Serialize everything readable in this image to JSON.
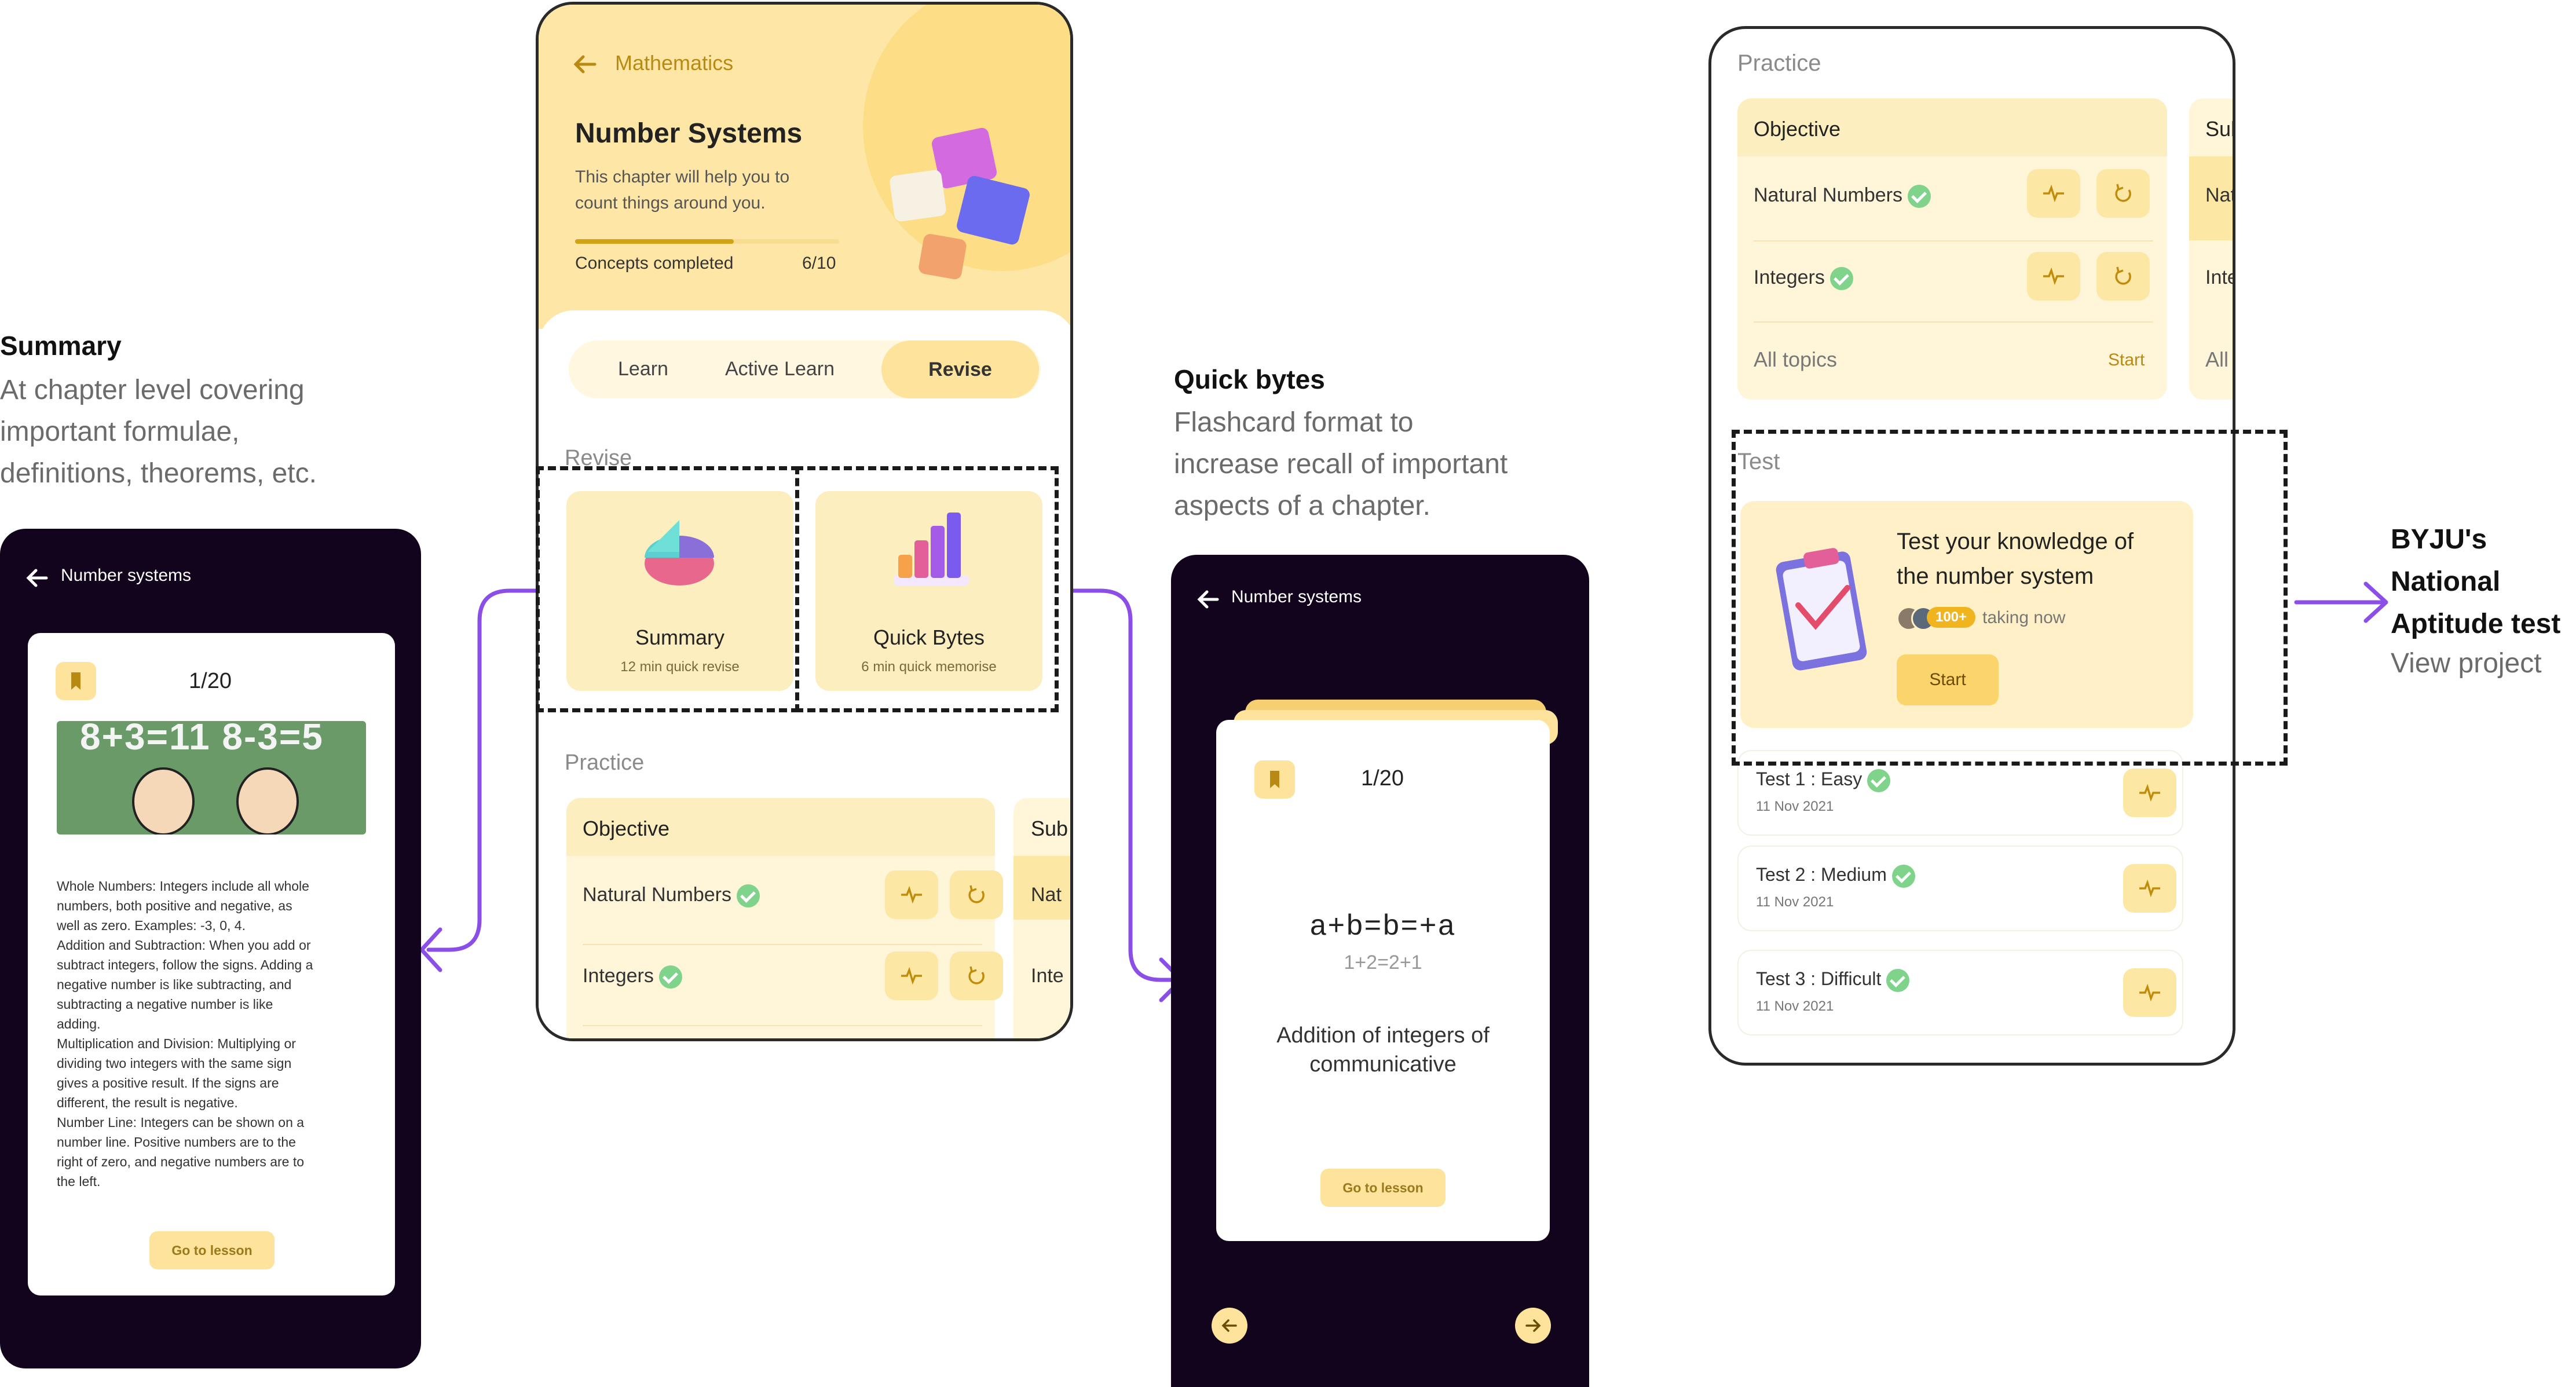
{
  "annotations": {
    "summary": {
      "title": "Summary",
      "lines": [
        "At chapter level covering",
        "important formulae,",
        "definitions, theorems, etc."
      ]
    },
    "quick_bytes": {
      "title": "Quick bytes",
      "lines": [
        "Flashcard format to",
        "increase recall of important",
        "aspects of a chapter."
      ]
    },
    "byjus": {
      "title_lines": [
        "BYJU's",
        "National",
        "Aptitude test"
      ],
      "link": "View project"
    }
  },
  "summary_screen": {
    "header": "Number systems",
    "counter": "1/20",
    "image_text": "8+3=11  8-3=5",
    "paragraphs": [
      "Whole Numbers: Integers include all whole",
      "numbers, both positive and negative, as",
      "well as zero. Examples: -3, 0, 4.",
      "Addition and Subtraction: When you add or",
      "subtract integers, follow the signs. Adding a",
      "negative number is like subtracting, and",
      "subtracting a negative number is like",
      "adding.",
      "Multiplication and Division: Multiplying or",
      "dividing two integers with the same sign",
      "gives a positive result. If the signs are",
      "different, the result is negative.",
      "Number Line: Integers can be shown on a",
      "number line. Positive numbers are to the",
      "right of zero, and negative numbers are to",
      "the left."
    ],
    "button": "Go to lesson"
  },
  "chapter_screen": {
    "back_label": "Mathematics",
    "title": "Number Systems",
    "description_lines": [
      "This chapter will help you to",
      "count things around you."
    ],
    "progress_label": "Concepts completed",
    "progress_value": "6/10",
    "progress_fraction": 0.6,
    "tabs": [
      "Learn",
      "Active Learn",
      "Revise"
    ],
    "active_tab": "Revise",
    "revise_heading": "Revise",
    "summary_card": {
      "title": "Summary",
      "subtitle": "12 min quick revise"
    },
    "quick_card": {
      "title": "Quick Bytes",
      "subtitle": "6 min quick memorise"
    },
    "practice_heading": "Practice",
    "objective_heading": "Objective",
    "side_heading": "Sub",
    "topics": [
      "Natural Numbers",
      "Integers"
    ],
    "side_topics": [
      "Nat",
      "Inte"
    ]
  },
  "flash_screen": {
    "header": "Number systems",
    "counter": "1/20",
    "formula": "a+b=b=+a",
    "example": "1+2=2+1",
    "caption_lines": [
      "Addition of integers of",
      "communicative"
    ],
    "button": "Go to lesson"
  },
  "practice_screen": {
    "heading": "Practice",
    "objective_heading": "Objective",
    "side_heading": "Sub",
    "topics": [
      "Natural Numbers",
      "Integers"
    ],
    "side_topics": [
      "Nat",
      "Inte"
    ],
    "all_topics": "All topics",
    "all_side": "All",
    "start_link": "Start",
    "test_heading": "Test",
    "test_card": {
      "title_lines": [
        "Test your knowledge of",
        "the number system"
      ],
      "badge": "100+",
      "taking": "taking now",
      "button": "Start"
    },
    "tests": [
      {
        "name": "Test 1 : Easy",
        "date": "11 Nov 2021"
      },
      {
        "name": "Test 2 : Medium",
        "date": "11 Nov 2021"
      },
      {
        "name": "Test 3 : Difficult",
        "date": "11 Nov 2021"
      }
    ]
  },
  "colors": {
    "accent": "#f0c14b",
    "accent_dark": "#b98a13",
    "dark_bg": "#12041c",
    "purple": "#8b4fe8",
    "check": "#7fd38a"
  }
}
